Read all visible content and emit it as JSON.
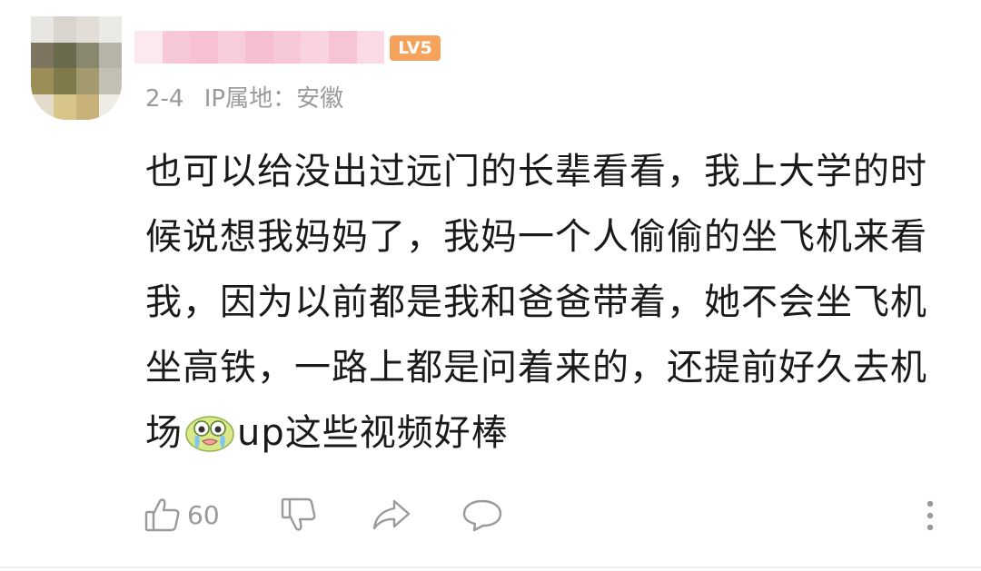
{
  "comment": {
    "level_badge": "LV5",
    "date": "2-4",
    "ip_location": "IP属地：安徽",
    "content_lines": [
      "也可以给没出过远门的长辈看看，我上大学的时",
      "候说想我妈妈了，我妈一个人偷偷的坐飞机来看",
      "我，因为以前都是我和爸爸带着，她不会坐飞机",
      "坐高铁，一路上都是问着来的，还提前好久去机"
    ],
    "last_line_before_emoji": "场",
    "last_line_after_emoji": "up这些视频好棒",
    "emoji_name": "crying-emoji",
    "like_count": "60"
  },
  "icons": {
    "like": "thumbs-up-icon",
    "dislike": "thumbs-down-icon",
    "share": "share-icon",
    "reply": "comment-icon",
    "more": "more-vertical-icon"
  },
  "colors": {
    "level_badge": "#f5a25d",
    "meta_text": "#9a9a9a",
    "content_text": "#1a1a1a",
    "icon_gray": "#9a9a9a"
  }
}
